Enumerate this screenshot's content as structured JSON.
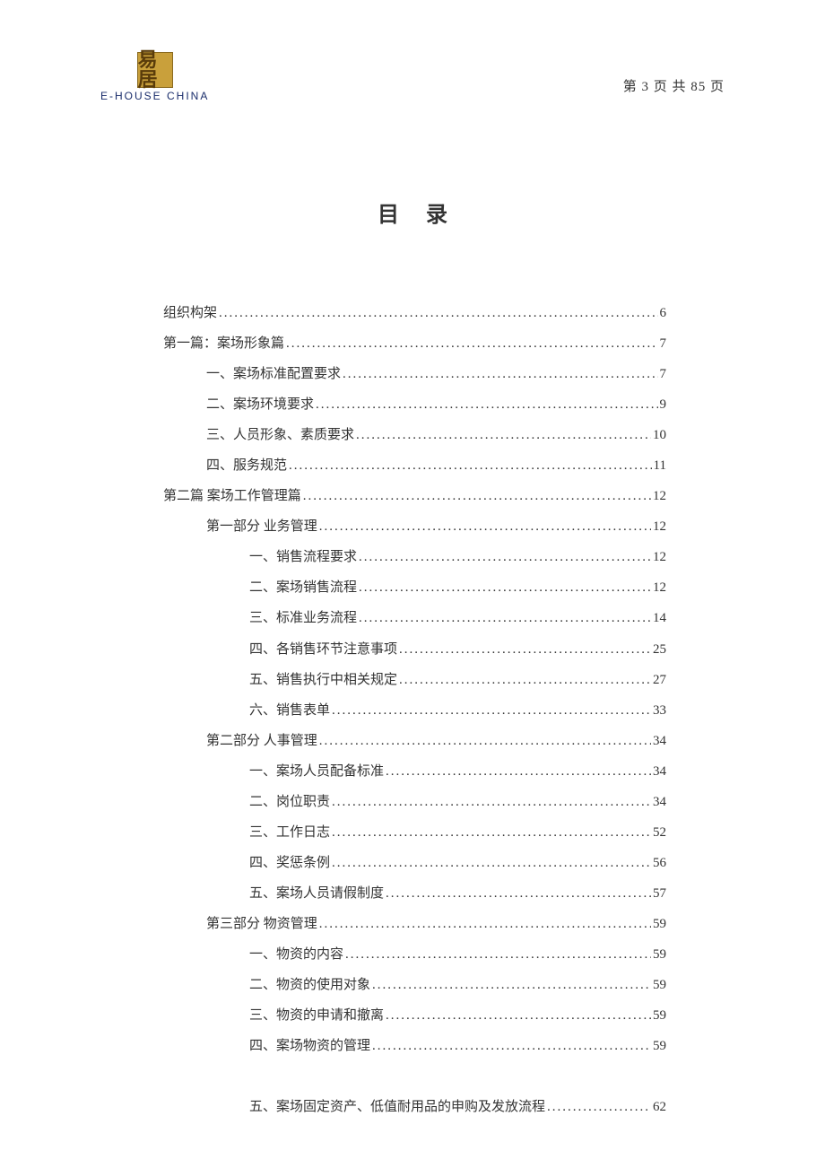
{
  "header": {
    "logo_mark": "易居",
    "logo_text": "E-HOUSE  CHINA",
    "page_text": "第 3 页  共 85 页"
  },
  "title": "目录",
  "toc": [
    {
      "indent": 0,
      "label": "组织构架",
      "page": "6"
    },
    {
      "indent": 0,
      "label": "第一篇：案场形象篇",
      "page": "7"
    },
    {
      "indent": 1,
      "label": "一、案场标准配置要求",
      "page": "7"
    },
    {
      "indent": 1,
      "label": "二、案场环境要求",
      "page": "9"
    },
    {
      "indent": 1,
      "label": "三、人员形象、素质要求",
      "page": "10"
    },
    {
      "indent": 1,
      "label": "四、服务规范",
      "page": "11"
    },
    {
      "indent": 0,
      "label": "第二篇   案场工作管理篇",
      "page": "12"
    },
    {
      "indent": 1,
      "label": "第一部分   业务管理",
      "page": "12"
    },
    {
      "indent": 2,
      "label": "一、销售流程要求 ",
      "page": "12"
    },
    {
      "indent": 2,
      "label": "二、案场销售流程 ",
      "page": "12"
    },
    {
      "indent": 2,
      "label": "三、标准业务流程 ",
      "page": "14"
    },
    {
      "indent": 2,
      "label": "四、各销售环节注意事项 ",
      "page": "25"
    },
    {
      "indent": 2,
      "label": "五、销售执行中相关规定 ",
      "page": "27"
    },
    {
      "indent": 2,
      "label": "六、销售表单 ",
      "page": "33"
    },
    {
      "indent": 1,
      "label": "第二部分   人事管理 ",
      "page": "34"
    },
    {
      "indent": 2,
      "label": "一、案场人员配备标准 ",
      "page": "34"
    },
    {
      "indent": 2,
      "label": "二、岗位职责 ",
      "page": "34"
    },
    {
      "indent": 2,
      "label": "三、工作日志 ",
      "page": "52"
    },
    {
      "indent": 2,
      "label": "四、奖惩条例 ",
      "page": "56"
    },
    {
      "indent": 2,
      "label": "五、案场人员请假制度 ",
      "page": "57"
    },
    {
      "indent": 1,
      "label": "第三部分   物资管理 ",
      "page": "59"
    },
    {
      "indent": 2,
      "label": "一、物资的内容 ",
      "page": "59"
    },
    {
      "indent": 2,
      "label": "二、物资的使用对象 ",
      "page": "59"
    },
    {
      "indent": 2,
      "label": "三、物资的申请和撤离 ",
      "page": "59"
    },
    {
      "indent": 2,
      "label": "四、案场物资的管理 ",
      "page": "59"
    },
    {
      "gap": true
    },
    {
      "indent": 2,
      "label": "五、案场固定资产、低值耐用品的申购及发放流程 ",
      "page": "62"
    }
  ]
}
